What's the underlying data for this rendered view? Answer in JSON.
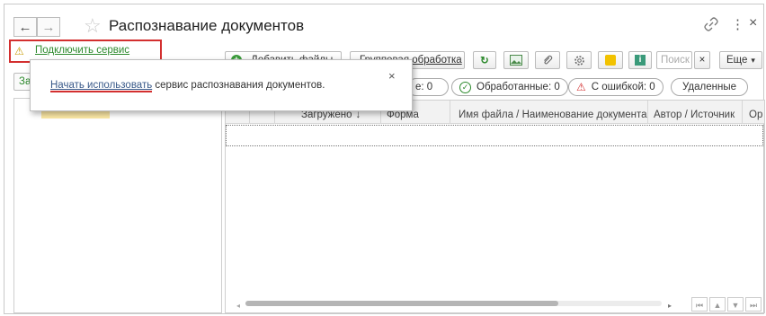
{
  "window": {
    "title": "Распознавание документов",
    "back_icon": "←",
    "forward_icon": "→",
    "star_icon": "☆",
    "link_icon": "🔗",
    "more_icon": "⋮",
    "close_icon": "×"
  },
  "warning": {
    "icon": "⚠",
    "label": "Подключить сервис"
  },
  "toolbar": {
    "add_files_label": "Добавить файлы",
    "group_label": "Групповая обработка",
    "search_placeholder": "Поиск",
    "clear_label": "×",
    "more_label": "Еще",
    "more_arrow": "▾"
  },
  "filters": {
    "first_suffix": "е: 0",
    "processed": "Обработанные: 0",
    "errors": "С ошибкой: 0",
    "deleted": "Удаленные"
  },
  "left_panel": {
    "button_partial": "За"
  },
  "table": {
    "columns": [
      "Загружено",
      "Форма",
      "Имя файла / Наименование документа",
      "Автор / Источник",
      "Ор"
    ],
    "sort_indicator": "↓"
  },
  "popup": {
    "link": "Начать использовать",
    "text": " сервис распознавания документов.",
    "close": "×"
  },
  "pager": {
    "first": "⏮",
    "up": "▲",
    "down": "▼",
    "last": "⏭"
  },
  "colors": {
    "accent_red": "#d32f2f",
    "link_green": "#2d8a2d",
    "link_blue": "#3a5a8a",
    "warning_yellow": "#f2c200"
  }
}
